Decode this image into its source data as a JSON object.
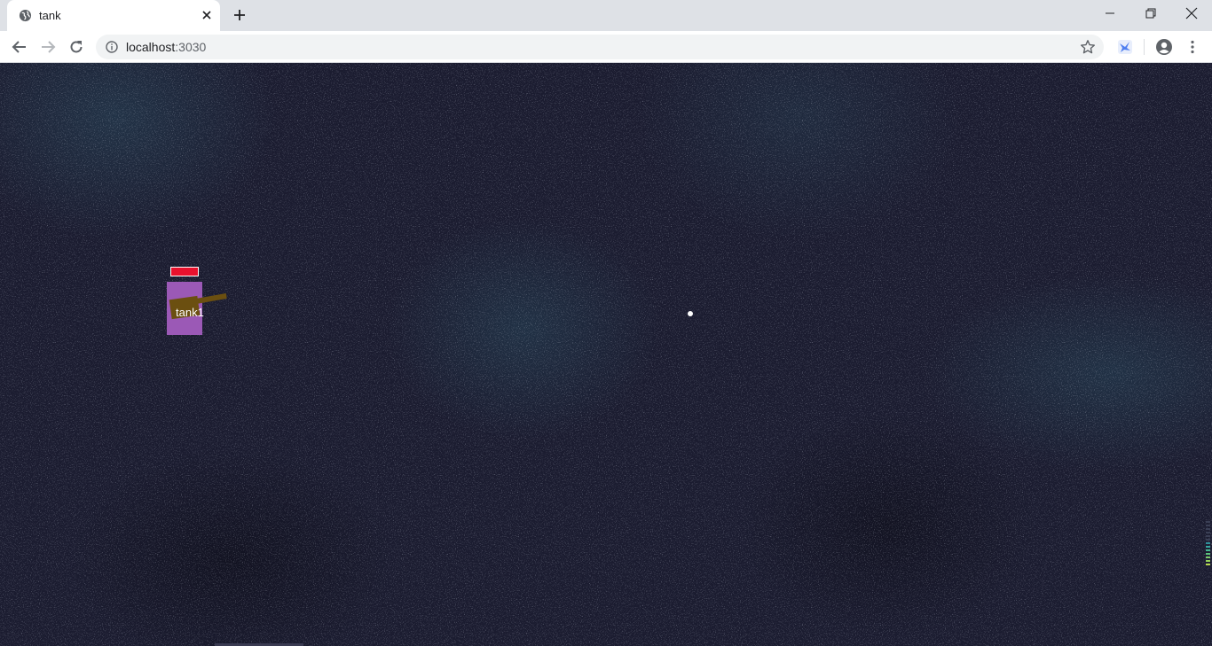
{
  "browser": {
    "tab": {
      "title": "tank",
      "favicon": "globe-icon",
      "close_icon": "close-icon"
    },
    "new_tab_icon": "plus-icon",
    "window_controls": {
      "minimize_icon": "minimize-icon",
      "restore_icon": "restore-icon",
      "close_icon": "close-icon"
    },
    "toolbar": {
      "back_icon": "arrow-left-icon",
      "forward_icon": "arrow-right-icon",
      "reload_icon": "reload-icon",
      "info_icon": "info-icon",
      "url_host": "localhost",
      "url_port": ":3030",
      "bookmark_icon": "star-icon",
      "extension_icon": "bird-extension-icon",
      "profile_icon": "account-icon",
      "menu_icon": "vertical-dots-icon"
    }
  },
  "game": {
    "background_color": "#1b1c30",
    "tank": {
      "label": "tank1",
      "body_color": "#9b59b6",
      "turret_color": "#6b4f10",
      "health_fraction": 1.0,
      "health_color": "#e8112d"
    },
    "bullet_color": "#ffffff"
  }
}
